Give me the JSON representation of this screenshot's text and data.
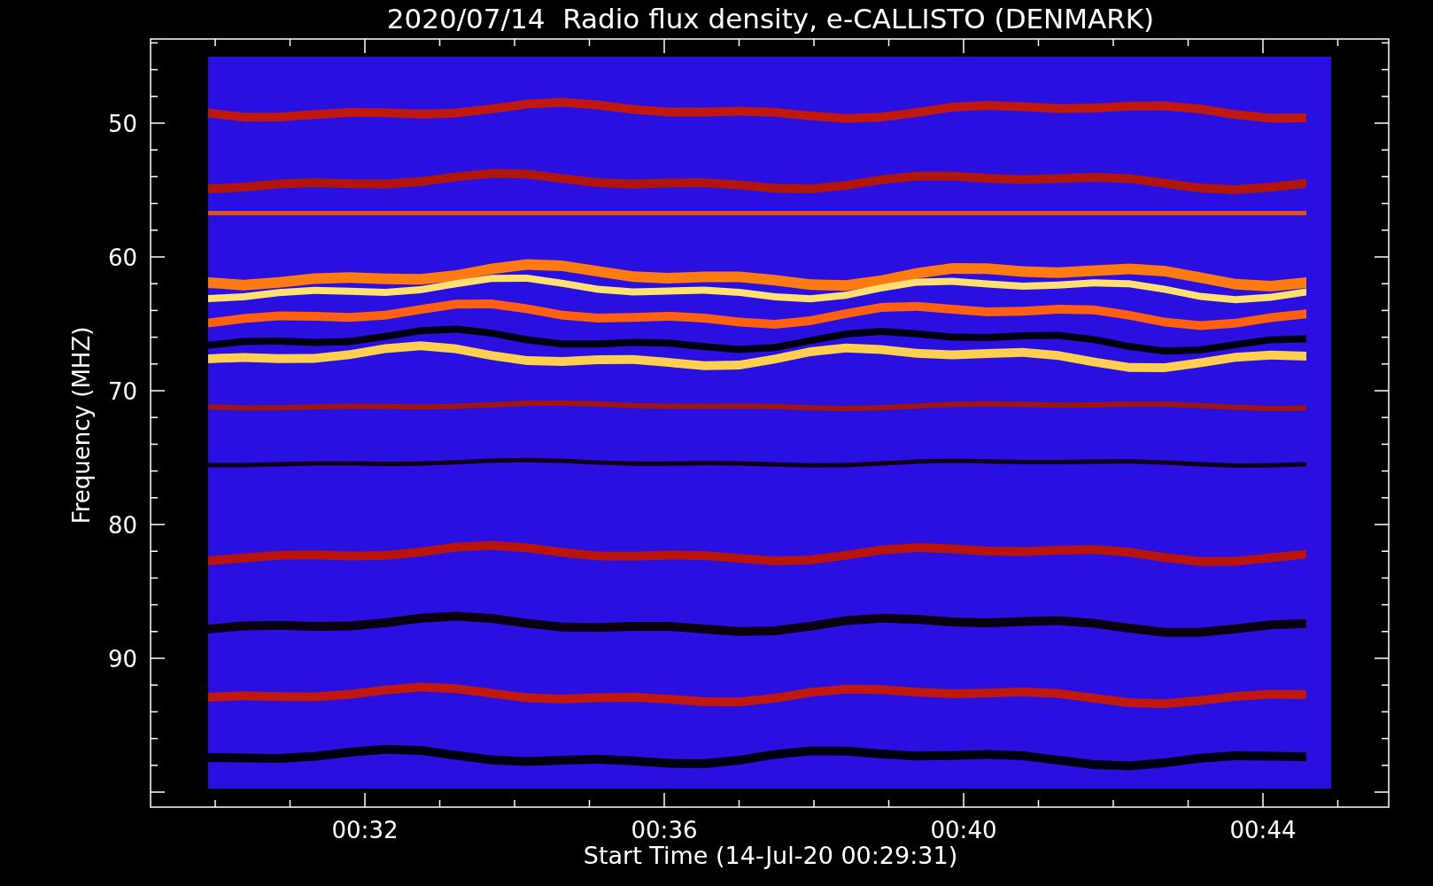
{
  "title": "2020/07/14  Radio flux density, e-CALLISTO (DENMARK)",
  "plot": {
    "ylabel": "Frequency (MHZ)",
    "xlabel": "Start Time (14-Jul-20 00:29:31)",
    "yticks": [
      "50",
      "60",
      "70",
      "80",
      "90"
    ],
    "xticks": [
      "00:32",
      "00:36",
      "00:40",
      "00:44"
    ]
  }
}
